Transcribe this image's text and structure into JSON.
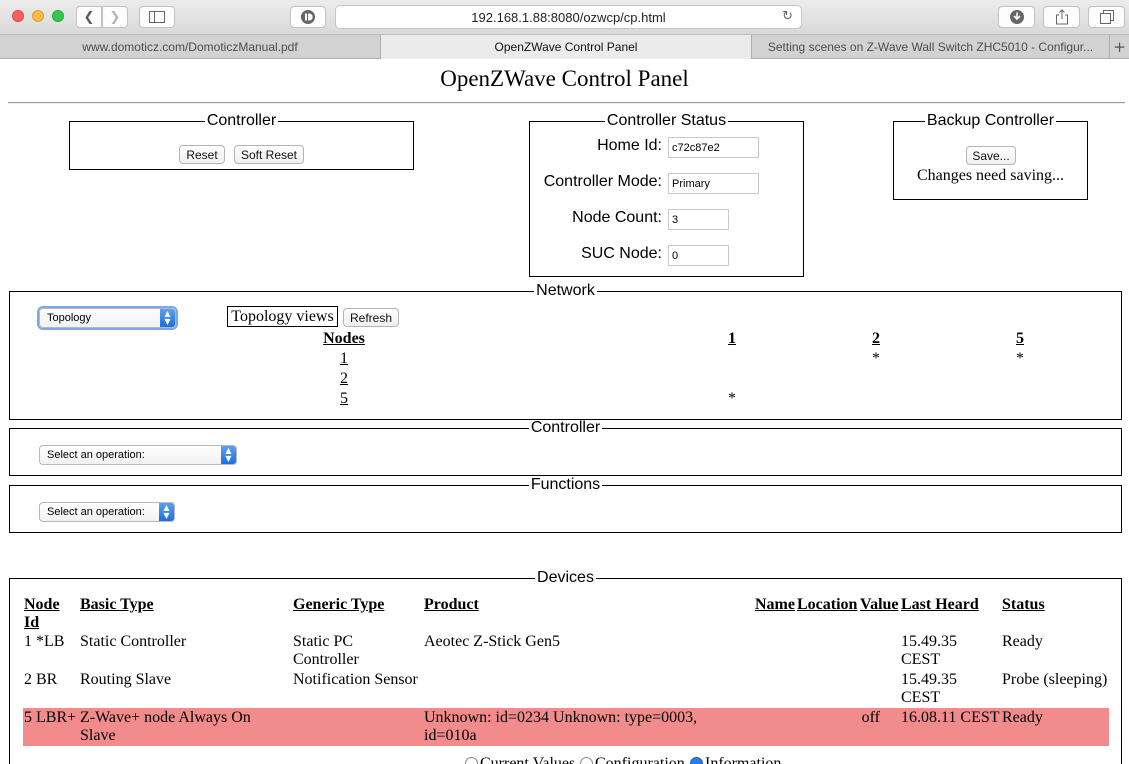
{
  "browser": {
    "url": "192.168.1.88:8080/ozwcp/cp.html",
    "tabs": [
      {
        "label": "www.domoticz.com/DomoticzManual.pdf"
      },
      {
        "label": "OpenZWave Control Panel"
      },
      {
        "label": "Setting scenes on Z-Wave Wall Switch ZHC5010 - Configur..."
      }
    ],
    "new_tab_label": "+"
  },
  "page": {
    "title": "OpenZWave Control Panel"
  },
  "controller": {
    "legend": "Controller",
    "reset_label": "Reset",
    "soft_reset_label": "Soft Reset"
  },
  "status": {
    "legend": "Controller Status",
    "home_id_label": "Home Id:",
    "home_id": "c72c87e2",
    "mode_label": "Controller Mode:",
    "mode": "Primary",
    "node_count_label": "Node Count:",
    "node_count": "3",
    "suc_label": "SUC Node:",
    "suc": "0"
  },
  "backup": {
    "legend": "Backup Controller",
    "save_label": "Save...",
    "message": "Changes need saving..."
  },
  "network": {
    "legend": "Network",
    "view_select": "Topology",
    "views_label": "Topology views",
    "refresh_label": "Refresh",
    "nodes_header": "Nodes",
    "columns": [
      "1",
      "2",
      "5"
    ],
    "rows": [
      {
        "node": "1",
        "cells": [
          "",
          "*",
          "*"
        ]
      },
      {
        "node": "2",
        "cells": [
          "",
          "",
          ""
        ]
      },
      {
        "node": "5",
        "cells": [
          "*",
          "",
          ""
        ]
      }
    ]
  },
  "controller_ops": {
    "legend": "Controller",
    "select": "Select an operation:"
  },
  "functions": {
    "legend": "Functions",
    "select": "Select an operation:"
  },
  "devices": {
    "legend": "Devices",
    "headers": {
      "node": "Node Id",
      "basic": "Basic Type",
      "generic": "Generic Type",
      "product": "Product",
      "name": "Name",
      "location": "Location",
      "value": "Value",
      "last_heard": "Last Heard",
      "status": "Status"
    },
    "rows": [
      {
        "node": "1 *LB",
        "basic": "Static Controller",
        "generic": "Static PC Controller",
        "product": "Aeotec Z-Stick Gen5",
        "name": "",
        "location": "",
        "value": "",
        "last_heard": "15.49.35 CEST",
        "status": "Ready"
      },
      {
        "node": "2 BR",
        "basic": "Routing Slave",
        "generic": "Notification Sensor",
        "product": "",
        "name": "",
        "location": "",
        "value": "",
        "last_heard": "15.49.35 CEST",
        "status": "Probe (sleeping)"
      },
      {
        "node": "5 LBR+",
        "basic": "Z-Wave+ node Always On Slave",
        "generic": "",
        "product": "Unknown: id=0234 Unknown: type=0003, id=010a",
        "name": "",
        "location": "",
        "value": "off",
        "last_heard": "16.08.11 CEST",
        "status": "Ready"
      }
    ],
    "highlight_color": "#f28b8b"
  },
  "view_options": [
    "Current Values",
    "Configuration",
    "Information"
  ],
  "selected_view": "Information"
}
